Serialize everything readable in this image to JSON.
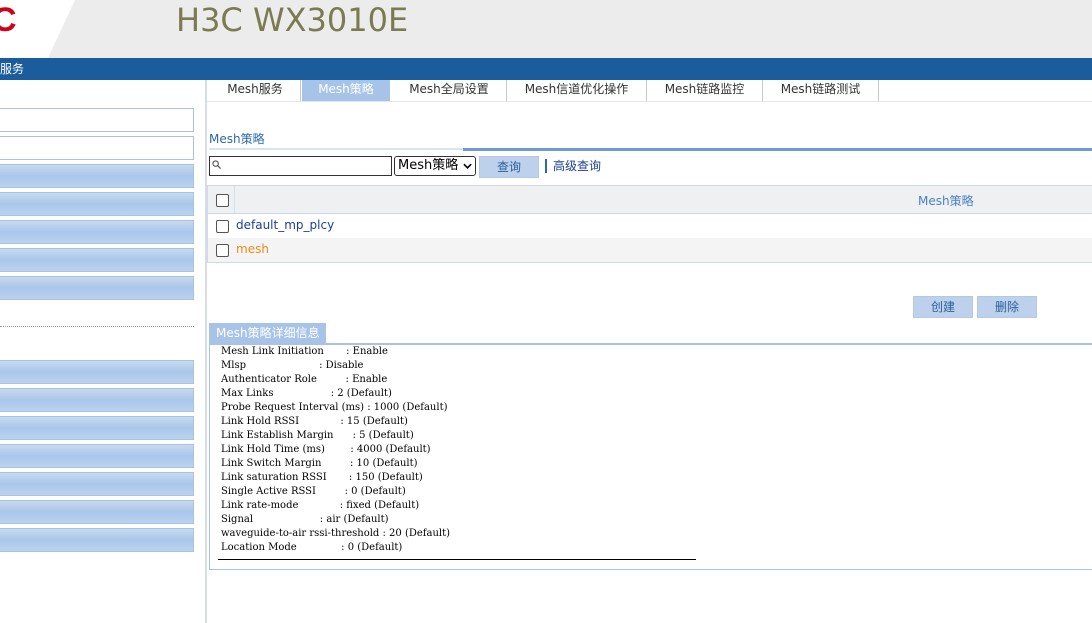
{
  "header": {
    "logo_text": "C",
    "product_name": "H3C WX3010E",
    "bar_label": "服务"
  },
  "tabs": [
    {
      "label": "Mesh服务"
    },
    {
      "label": "Mesh策略"
    },
    {
      "label": "Mesh全局设置"
    },
    {
      "label": "Mesh信道优化操作"
    },
    {
      "label": "Mesh链路监控"
    },
    {
      "label": "Mesh链路测试"
    }
  ],
  "active_tab": "Mesh策略",
  "section": {
    "title": "Mesh策略"
  },
  "search": {
    "value": "",
    "select_value": "Mesh策略",
    "query_label": "查询",
    "advanced_label": "高级查询"
  },
  "table": {
    "header": "Mesh策略",
    "rows": [
      {
        "name": "default_mp_plcy"
      },
      {
        "name": "mesh"
      }
    ]
  },
  "actions": {
    "create_label": "创建",
    "delete_label": "删除"
  },
  "detail": {
    "title": "Mesh策略详细信息",
    "text": "Mesh Link Initiation       : Enable\nMlsp                       : Disable\nAuthenticator Role         : Enable\nMax Links                  : 2 (Default)\nProbe Request Interval (ms) : 1000 (Default)\nLink Hold RSSI             : 15 (Default)\nLink Establish Margin      : 5 (Default)\nLink Hold Time (ms)        : 4000 (Default)\nLink Switch Margin         : 10 (Default)\nLink saturation RSSI       : 150 (Default)\nSingle Active RSSI         : 0 (Default)\nLink rate-mode             : fixed (Default)\nSignal                     : air (Default)\nwaveguide-to-air rssi-threshold : 20 (Default)\nLocation Mode              : 0 (Default)"
  },
  "colors": {
    "brand_red": "#d0021b",
    "top_bar_blue": "#1a5c9c",
    "active_tab": "#a7c4e8",
    "link_blue": "#1c3f94",
    "link_orange": "#ee8c1a"
  }
}
